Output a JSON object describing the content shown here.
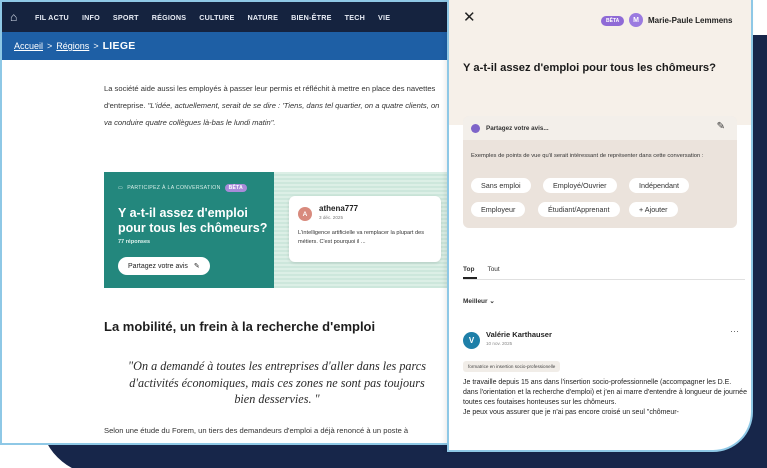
{
  "nav": {
    "items": [
      "FIL ACTU",
      "INFO",
      "SPORT",
      "RÉGIONS",
      "CULTURE",
      "NATURE",
      "BIEN-ÊTRE",
      "TECH",
      "VIE"
    ]
  },
  "breadcrumb": {
    "home": "Accueil",
    "region": "Régions",
    "current": "LIEGE"
  },
  "article": {
    "para1_a": "La société aide aussi les employés à passer leur permis et réfléchit à mettre en place des navettes d'entreprise. ",
    "para1_quote": "\"L'idée, actuellement, serait de se dire : 'Tiens, dans tel quartier, on a quatre clients, on va conduire quatre collègues là-bas le lundi matin\".",
    "section_title": "La mobilité, un frein à la recherche d'emploi",
    "quote": "\"On a demandé à toutes les entreprises d'aller dans les parcs d'activités économiques, mais ces zones ne sont pas toujours bien desservies. \"",
    "para2": "Selon une étude du Forem, un tiers des demandeurs d'emploi a déjà renoncé à un poste à"
  },
  "convo_card": {
    "kicker": "PARTICIPEZ À LA CONVERSATION",
    "beta": "BÊTA",
    "title": "Y a-t-il assez d'emploi pour tous les chômeurs?",
    "count": "77 réponses",
    "share_label": "Partagez votre avis",
    "comment": {
      "avatar": "A",
      "user": "athena777",
      "date": "3 déc. 2025",
      "text": "L'intelligence artificielle va remplacer la plupart des métiers. C'est pourquoi il ..."
    }
  },
  "panel": {
    "close": "✕",
    "beta": "BÊTA",
    "user_initial": "M",
    "user_name": "Marie-Paule Lemmens",
    "title": "Y a-t-il assez d'emploi pour tous les chômeurs?",
    "share_placeholder": "Partagez votre avis...",
    "suggest_text": "Exemples de points de vue qu'il serait intéressant de représenter dans cette conversation :",
    "chips": [
      "Sans emploi",
      "Employé/Ouvrier",
      "Indépendant",
      "Employeur",
      "Étudiant/Apprenant",
      "+ Ajouter"
    ],
    "tabs": [
      "Top",
      "Tout"
    ],
    "sort": "Meilleur ⌄",
    "comment": {
      "avatar": "V",
      "user": "Valérie Karthauser",
      "date": "10 nov. 2025",
      "tag": "formatrice en insertion socio-professionelle",
      "body1": "Je travaille depuis 15 ans dans l'insertion socio-professionnelle (accompagner les D.E. dans l'orientation et la recherche d'emploi) et j'en ai marre d'entendre à longueur de journée toutes ces foutaises honteuses sur les chômeurs.",
      "body2": "Je peux vous assurer que je n'ai pas encore croisé un seul \"chômeur-"
    }
  }
}
